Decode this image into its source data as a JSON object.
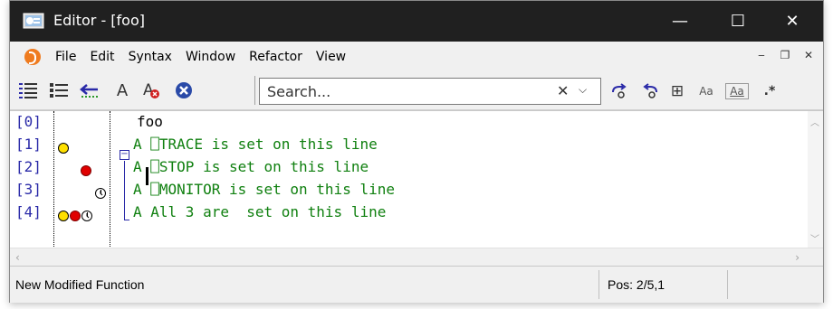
{
  "window": {
    "title": "Editor - [foo]",
    "controls": {
      "minimize": "—",
      "maximize": "☐",
      "close": "✕"
    }
  },
  "menubar": {
    "items": [
      {
        "label": "File"
      },
      {
        "label": "Edit"
      },
      {
        "label": "Syntax"
      },
      {
        "label": "Window"
      },
      {
        "label": "Refactor"
      },
      {
        "label": "View"
      }
    ],
    "mdi_controls": {
      "minimize": "‒",
      "restore": "❐",
      "close": "✕"
    }
  },
  "toolbar": {
    "buttons": [
      {
        "name": "list-icon",
        "glyph": "☰"
      },
      {
        "name": "list-bullet-icon",
        "glyph": "☷"
      },
      {
        "name": "back-arrow-icon",
        "glyph": "⇐"
      },
      {
        "name": "a-glyph-icon",
        "glyph": "A"
      },
      {
        "name": "a-remove-icon",
        "glyph": "A"
      },
      {
        "name": "clear-circle-icon",
        "glyph": "✖"
      }
    ],
    "search": {
      "placeholder": "Search...",
      "clear_glyph": "✕",
      "dropdown_glyph": "⌵"
    },
    "right_buttons": [
      {
        "name": "find-next-icon",
        "glyph": "↱"
      },
      {
        "name": "find-prev-icon",
        "glyph": "↰"
      },
      {
        "name": "expand-icon",
        "glyph": "⊞"
      },
      {
        "name": "match-case-icon",
        "glyph": "Aa"
      },
      {
        "name": "whole-word-icon",
        "glyph": "Aa"
      },
      {
        "name": "regex-icon",
        "glyph": ".*"
      }
    ]
  },
  "editor": {
    "lines": [
      {
        "gutter": "[0]",
        "text": "foo",
        "markers": []
      },
      {
        "gutter": "[1]",
        "text": "A ⎕TRACE is set on this line",
        "markers": [
          "trace"
        ]
      },
      {
        "gutter": "[2]",
        "text": "A ⎕STOP is set on this line",
        "markers": [
          "stop"
        ]
      },
      {
        "gutter": "[3]",
        "text": "A ⎕MONITOR is set on this line",
        "markers": [
          "monitor"
        ]
      },
      {
        "gutter": "[4]",
        "text": "A All 3 are  set on this line",
        "markers": [
          "trace",
          "stop",
          "monitor"
        ]
      }
    ],
    "colors": {
      "trace": "#ffe000",
      "stop": "#e00000",
      "code": "#108010",
      "gutter": "#2a2aa8"
    }
  },
  "statusbar": {
    "message": "New Modified Function",
    "position": "Pos: 2/5,1"
  }
}
